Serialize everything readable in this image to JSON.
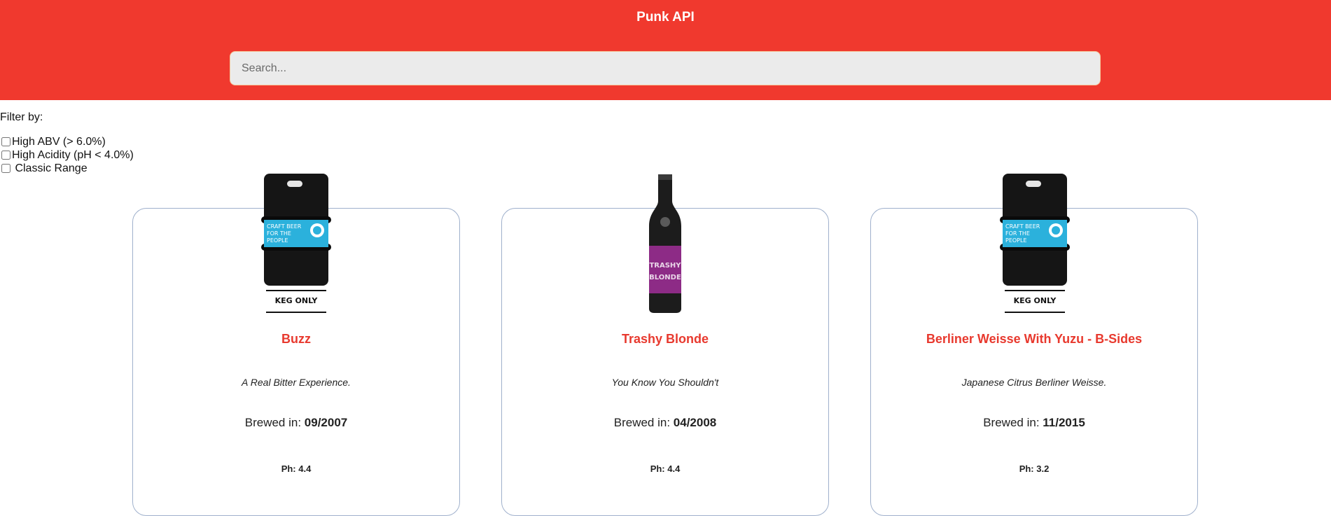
{
  "header": {
    "title": "Punk API",
    "background": "#f0392e"
  },
  "search": {
    "placeholder": "Search...",
    "value": ""
  },
  "filters": {
    "label": "Filter by:",
    "options": [
      {
        "label": "High ABV (> 6.0%)",
        "checked": false
      },
      {
        "label": "High Acidity (pH < 4.0%)",
        "checked": false
      },
      {
        "label": " Classic Range",
        "checked": false
      }
    ]
  },
  "beers": [
    {
      "name": "Buzz",
      "tagline": "A Real Bitter Experience.",
      "brewed_label": "Brewed in: ",
      "first_brewed": "09/2007",
      "ph_text": "Ph: 4.4",
      "image": "keg-image",
      "keg_label": "KEG ONLY",
      "keg_banner": [
        "CRAFT BEER",
        "FOR THE",
        "PEOPLE"
      ]
    },
    {
      "name": "Trashy Blonde",
      "tagline": "You Know You Shouldn't",
      "brewed_label": "Brewed in: ",
      "first_brewed": "04/2008",
      "ph_text": "Ph: 4.4",
      "image": "bottle-image",
      "bottle_label": [
        "TRASHY",
        "BLONDE"
      ]
    },
    {
      "name": "Berliner Weisse With Yuzu - B-Sides",
      "tagline": "Japanese Citrus Berliner Weisse.",
      "brewed_label": "Brewed in: ",
      "first_brewed": "11/2015",
      "ph_text": "Ph: 3.2",
      "image": "keg-image",
      "keg_label": "KEG ONLY",
      "keg_banner": [
        "CRAFT BEER",
        "FOR THE",
        "PEOPLE"
      ]
    }
  ]
}
